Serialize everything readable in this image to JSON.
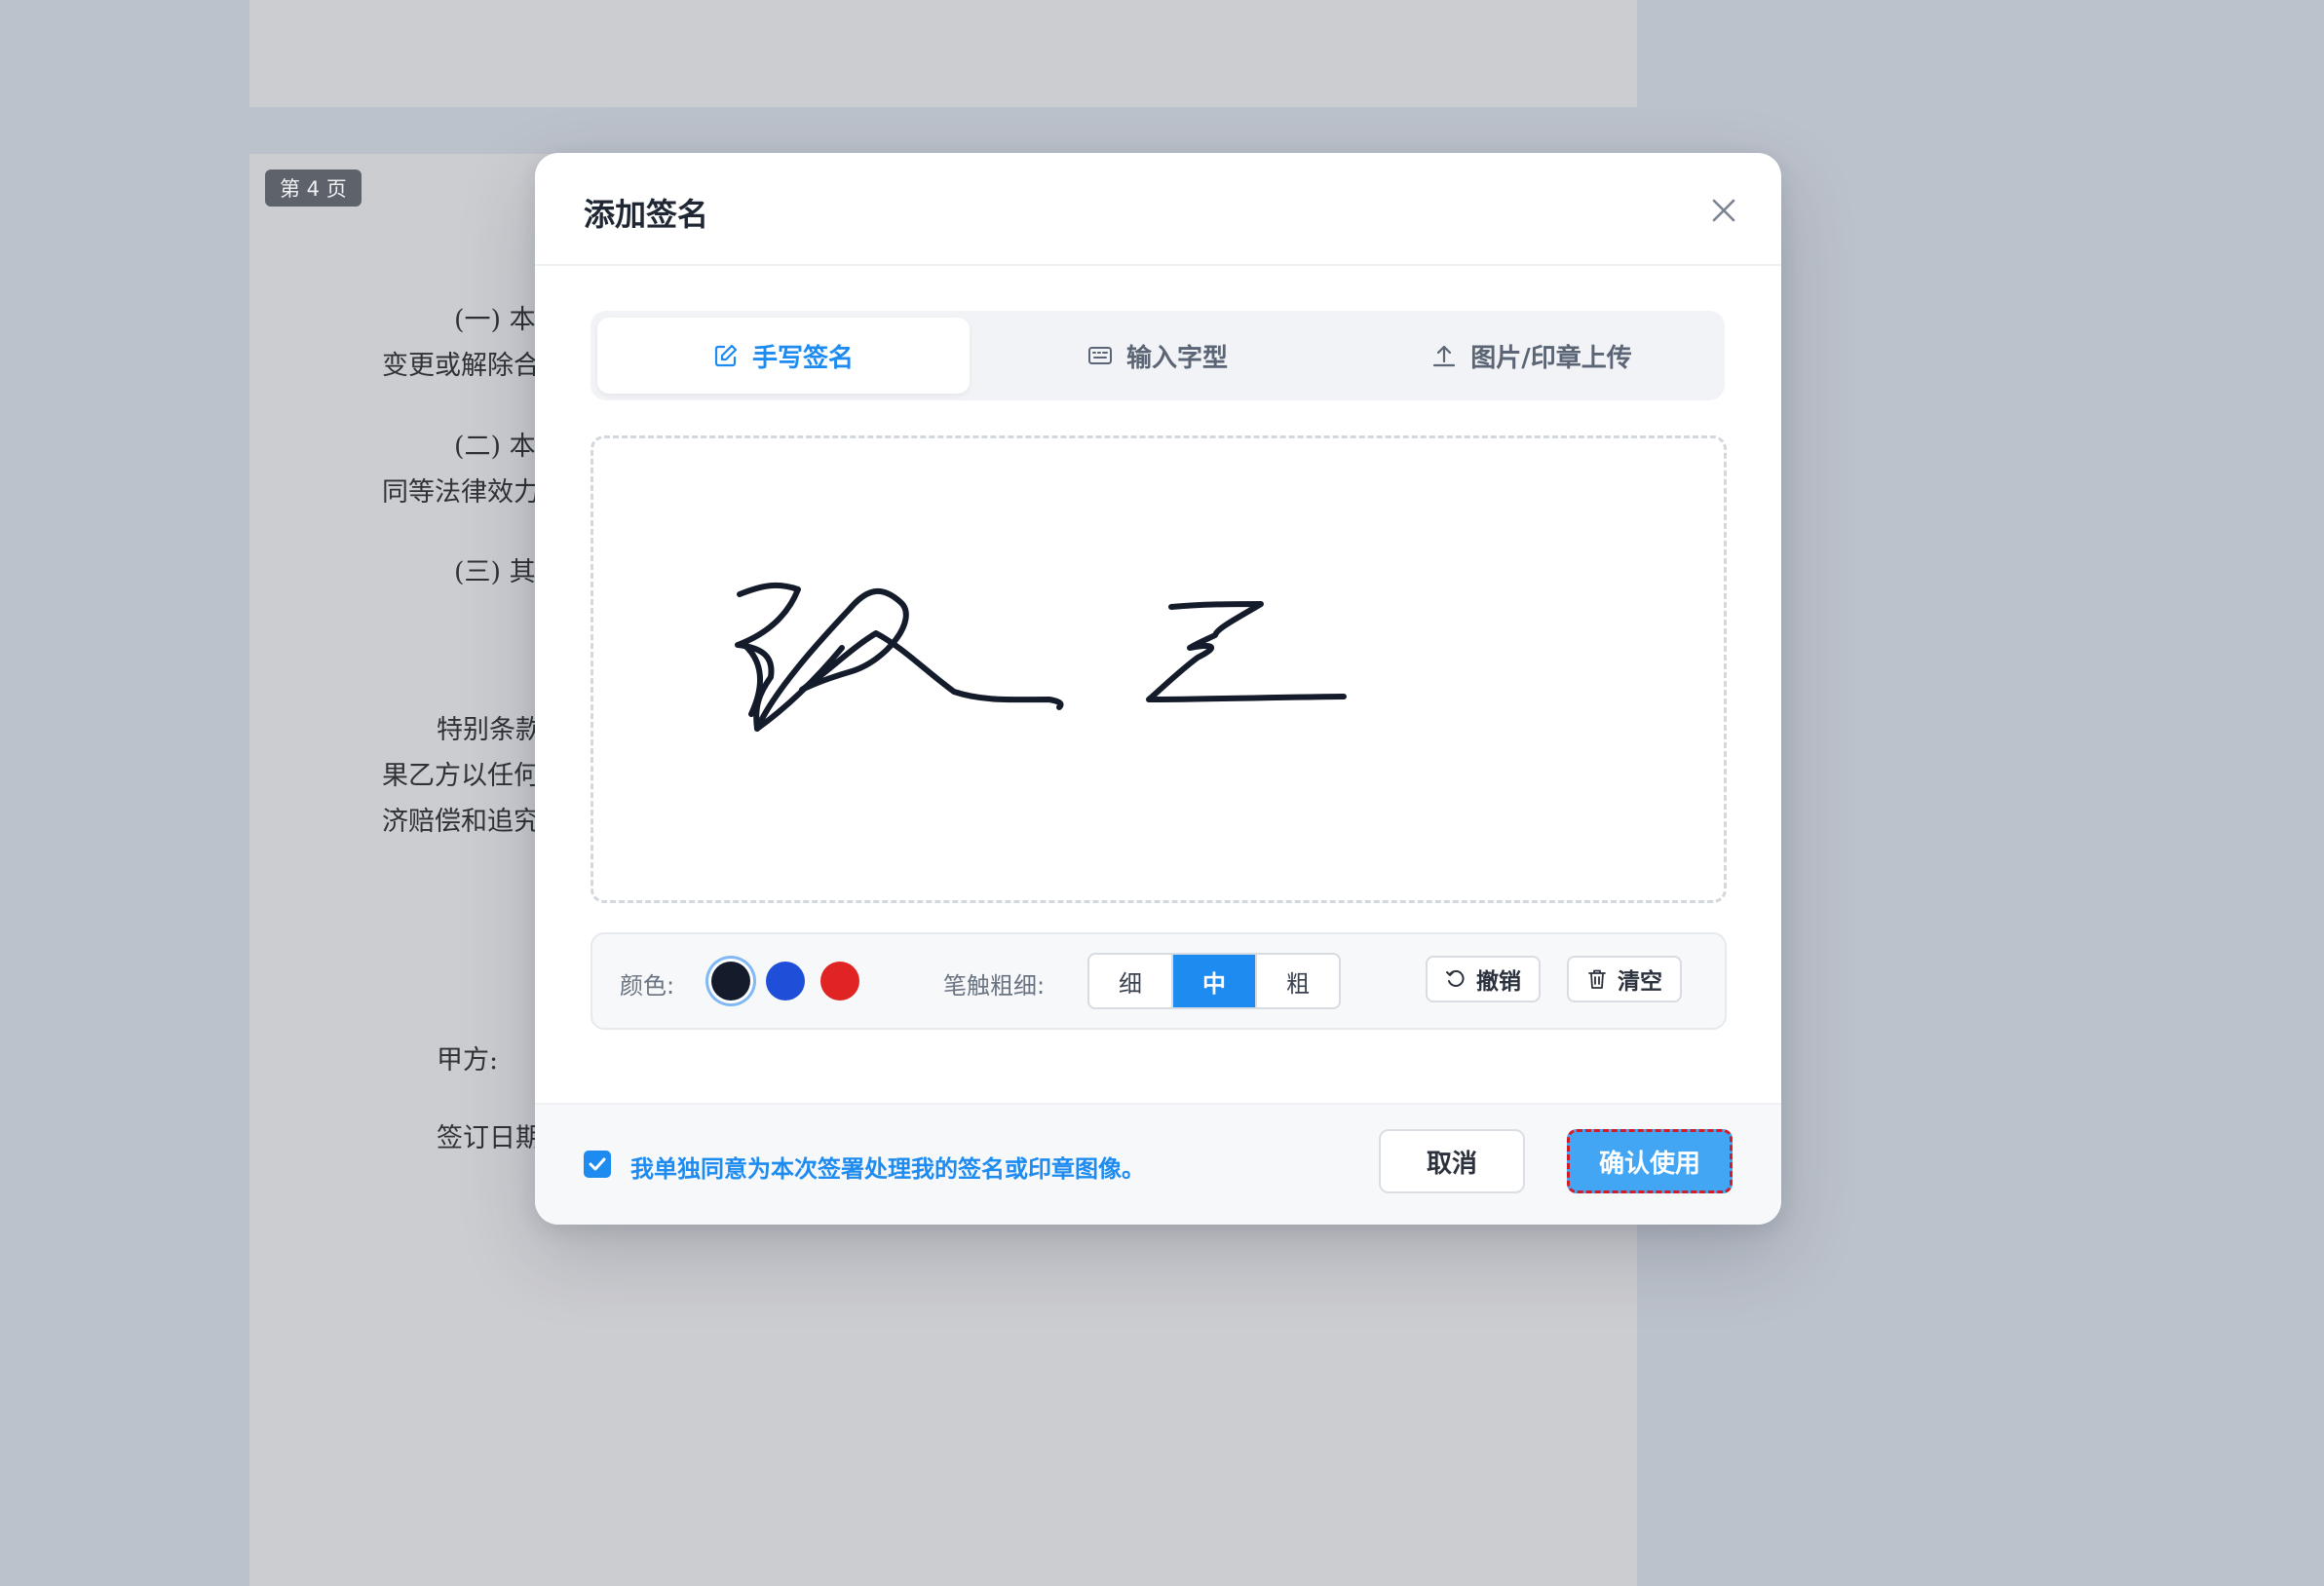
{
  "document": {
    "page_tag": "第 4 页",
    "lines": [
      "(一) 本",
      "变更或解除合",
      "(二) 本",
      "同等法律效力",
      "(三) 其",
      "特别条款",
      "果乙方以任何",
      "济赔偿和追究",
      "甲方:",
      "签订日期"
    ]
  },
  "modal": {
    "title": "添加签名",
    "close_icon": "close-icon",
    "tabs": [
      {
        "label": "手写签名",
        "icon": "edit-icon",
        "active": true
      },
      {
        "label": "输入字型",
        "icon": "keyboard-icon",
        "active": false
      },
      {
        "label": "图片/印章上传",
        "icon": "upload-icon",
        "active": false
      }
    ],
    "toolbar": {
      "color_label": "颜色:",
      "colors": [
        "#141b2b",
        "#1f4fd8",
        "#e02424"
      ],
      "selected_color": "#141b2b",
      "thickness_label": "笔触粗细:",
      "thickness_options": [
        "细",
        "中",
        "粗"
      ],
      "selected_thickness": "中",
      "undo_label": "撤销",
      "clear_label": "清空"
    },
    "footer": {
      "consent_text": "我单独同意为本次签署处理我的签名或印章图像。",
      "consent_checked": true,
      "cancel_label": "取消",
      "confirm_label": "确认使用"
    }
  }
}
